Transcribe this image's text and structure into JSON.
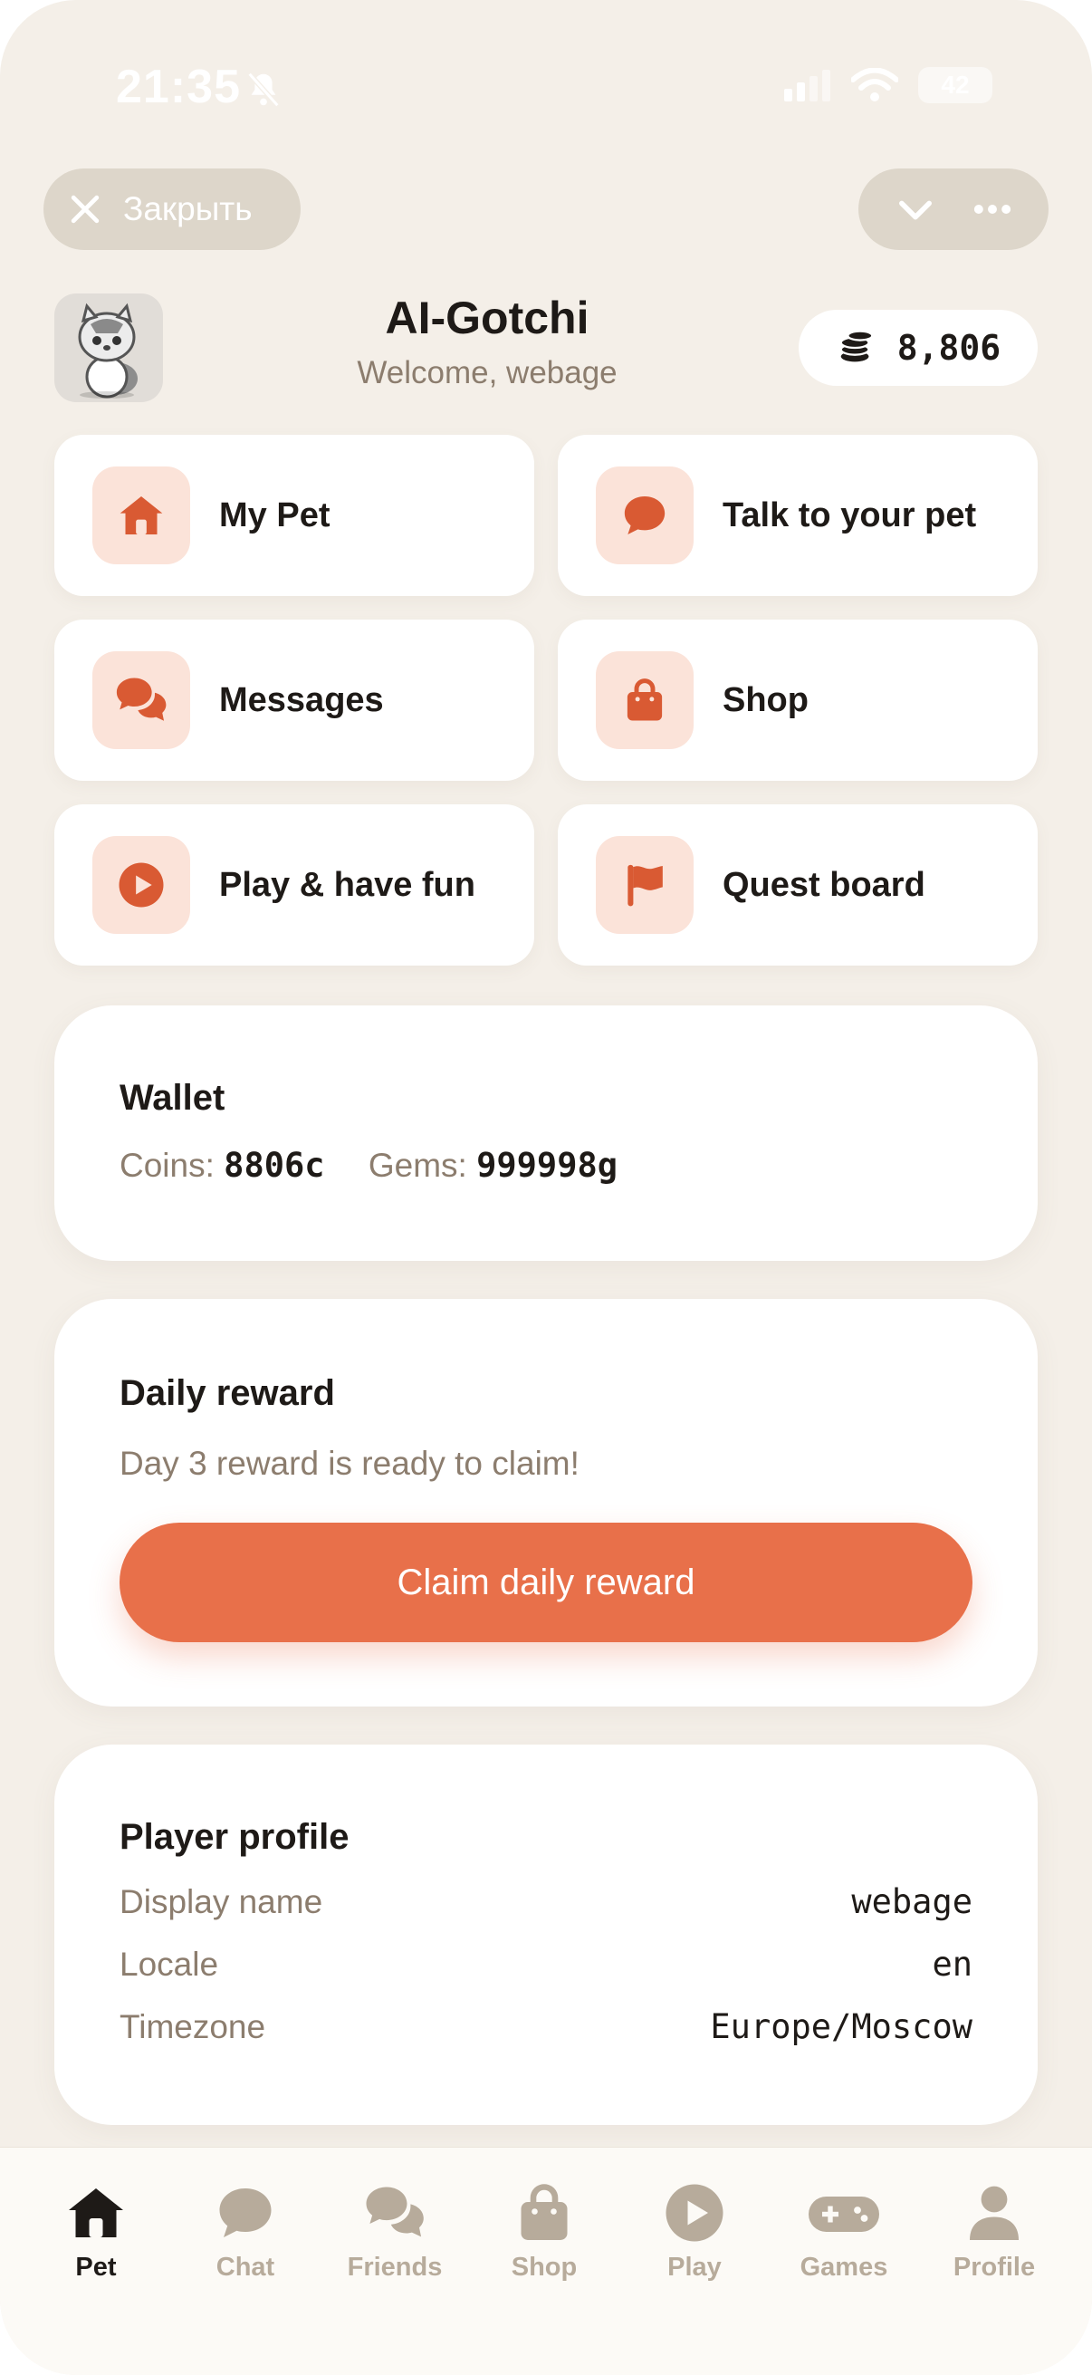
{
  "status_bar": {
    "time": "21:35",
    "battery": "42"
  },
  "telegram_header": {
    "close_label": "Закрыть"
  },
  "app": {
    "title": "AI-Gotchi",
    "subtitle": "Welcome, webage",
    "balance": "8,806"
  },
  "menu": [
    {
      "label": "My Pet",
      "icon": "home-icon"
    },
    {
      "label": "Talk to your pet",
      "icon": "chat-bubble-icon"
    },
    {
      "label": "Messages",
      "icon": "messages-icon"
    },
    {
      "label": "Shop",
      "icon": "shopping-bag-icon"
    },
    {
      "label": "Play & have fun",
      "icon": "play-icon"
    },
    {
      "label": "Quest board",
      "icon": "flag-icon"
    }
  ],
  "wallet": {
    "title": "Wallet",
    "coins_label": "Coins:",
    "coins_value": "8806c",
    "gems_label": "Gems:",
    "gems_value": "999998g"
  },
  "daily_reward": {
    "title": "Daily reward",
    "message": "Day 3 reward is ready to claim!",
    "button_label": "Claim daily reward"
  },
  "player_profile": {
    "title": "Player profile",
    "rows": [
      {
        "label": "Display name",
        "value": "webage"
      },
      {
        "label": "Locale",
        "value": "en"
      },
      {
        "label": "Timezone",
        "value": "Europe/Moscow"
      }
    ]
  },
  "bottom_nav": [
    {
      "label": "Pet",
      "icon": "home-icon",
      "active": true
    },
    {
      "label": "Chat",
      "icon": "chat-bubble-icon",
      "active": false
    },
    {
      "label": "Friends",
      "icon": "messages-icon",
      "active": false
    },
    {
      "label": "Shop",
      "icon": "shopping-bag-icon",
      "active": false
    },
    {
      "label": "Play",
      "icon": "play-icon",
      "active": false
    },
    {
      "label": "Games",
      "icon": "gamepad-icon",
      "active": false
    },
    {
      "label": "Profile",
      "icon": "user-icon",
      "active": false
    }
  ],
  "colors": {
    "background": "#f4efe8",
    "accent": "#e8704a",
    "icon_accent": "#d95a33",
    "icon_tile": "#fbe3d9",
    "nav_inactive": "#b7ab9b",
    "text_primary": "#1e1a17",
    "text_muted": "#8c7d6e"
  }
}
